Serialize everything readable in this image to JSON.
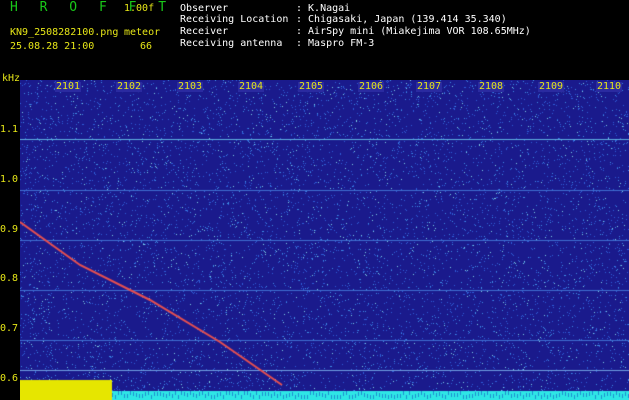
{
  "header": {
    "app_title": "H R O F F T",
    "version": "1.00f",
    "filename": "KN9_2508282100.png",
    "meteor_label": "meteor",
    "datetime": "25.08.28 21:00",
    "meteor_count": "66"
  },
  "info": {
    "observer_label": "Observer",
    "observer_value": ": K.Nagai",
    "location_label": "Receiving Location",
    "location_value": ": Chigasaki, Japan (139.414 35.340)",
    "receiver_label": "Receiver",
    "receiver_value": ": AirSpy mini (Miakejima VOR 108.65MHz)",
    "antenna_label": "Receiving antenna",
    "antenna_value": ": Maspro FM-3"
  },
  "axes": {
    "y_unit": "kHz",
    "y_ticks": [
      "1.1",
      "1.0",
      "0.9",
      "0.8",
      "0.7",
      "0.6"
    ],
    "x_ticks": [
      "2101",
      "2102",
      "2103",
      "2104",
      "2105",
      "2106",
      "2107",
      "2108",
      "2109",
      "2110"
    ]
  },
  "colors": {
    "background": "#1a1a8c",
    "noise": "#2e6ee6",
    "label": "#e6e617",
    "title": "#19c819",
    "trace": "#e65050",
    "lower_band": "#e6e600",
    "cyan_band": "#2ee6e6"
  }
}
